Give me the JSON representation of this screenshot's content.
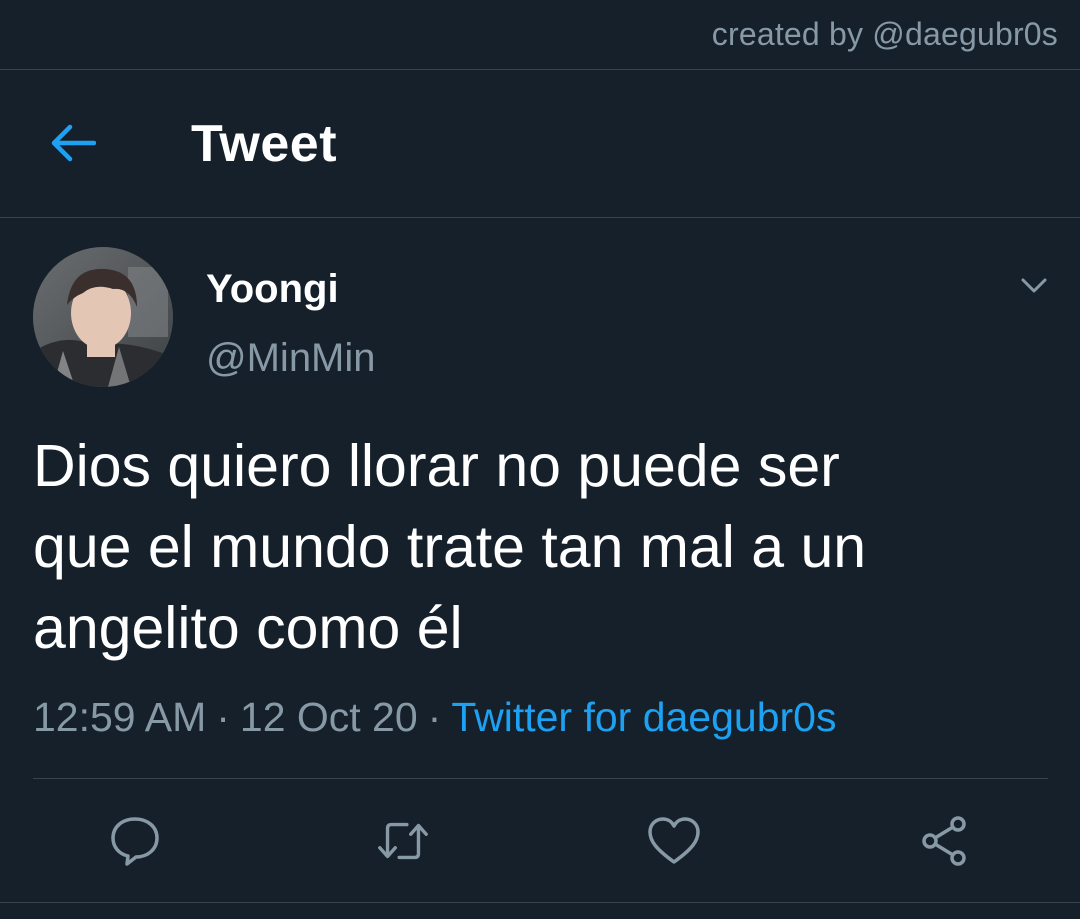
{
  "watermark": {
    "credit_text": "created by @daegubr0s"
  },
  "header": {
    "title": "Tweet",
    "back_icon": "arrow-left-icon"
  },
  "tweet": {
    "author": {
      "display_name": "Yoongi",
      "handle": "@MinMin"
    },
    "text": "Dios quiero llorar no puede ser\nque el mundo trate tan mal a un\nangelito como él",
    "time": "12:59 AM",
    "date": "12 Oct 20",
    "separator": "·",
    "source": "Twitter for daegubr0s"
  },
  "actions": [
    {
      "name": "reply",
      "icon": "comment-icon"
    },
    {
      "name": "retweet",
      "icon": "retweet-icon"
    },
    {
      "name": "like",
      "icon": "heart-icon"
    },
    {
      "name": "share",
      "icon": "share-icon"
    }
  ],
  "colors": {
    "background": "#15202b",
    "accent": "#1da1f2",
    "secondary_text": "#8899a6",
    "divider": "#38444d"
  }
}
